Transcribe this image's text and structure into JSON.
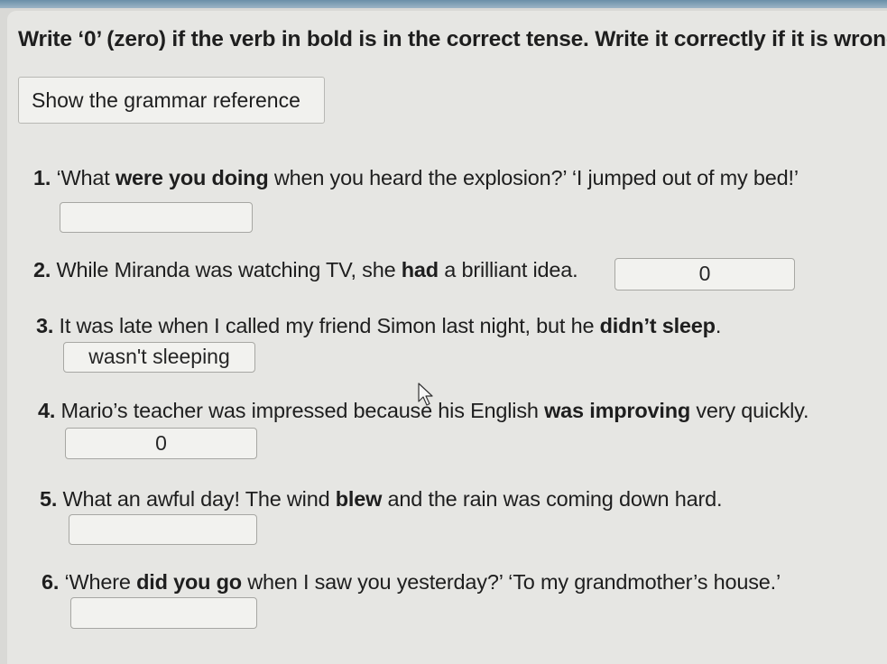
{
  "instruction": {
    "part1": "Write ‘0’ (zero) if the verb in ",
    "bold_word": "bold",
    "part2": " is in the correct tense. Write it correctly if it is wrong."
  },
  "grammar_button": "Show the grammar reference",
  "questions": [
    {
      "number": "1.",
      "before": " ‘What ",
      "bold": "were you doing",
      "after": " when you heard the explosion?’ ‘I jumped out of my bed!’",
      "answer": ""
    },
    {
      "number": "2.",
      "before": " While Miranda was watching TV, she ",
      "bold": "had",
      "after": " a brilliant idea.",
      "answer": "0"
    },
    {
      "number": "3.",
      "before": " It was late when I called my friend Simon last night, but he ",
      "bold": "didn’t sleep",
      "after": ".",
      "answer": "wasn't sleeping"
    },
    {
      "number": "4.",
      "before": " Mario’s teacher was impressed because his English ",
      "bold": "was improving",
      "after": " very quickly.",
      "answer": "0"
    },
    {
      "number": "5.",
      "before": " What an awful day! The wind ",
      "bold": "blew",
      "after": " and the rain was coming down hard.",
      "answer": ""
    },
    {
      "number": "6.",
      "before": " ‘Where ",
      "bold": "did you go",
      "after": " when I saw you yesterday?’ ‘To my grandmother’s house.’",
      "answer": ""
    }
  ]
}
